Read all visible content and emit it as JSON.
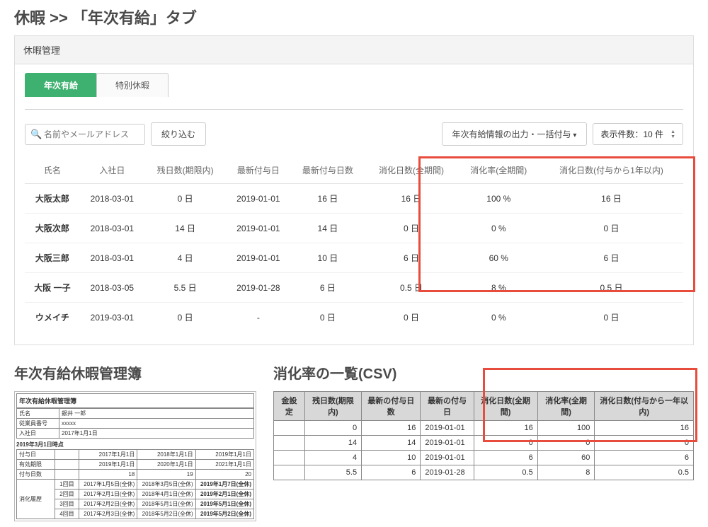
{
  "title": "休暇 >> 「年次有給」タブ",
  "panel_header": "休暇管理",
  "tabs": {
    "active": "年次有給",
    "other": "特別休暇"
  },
  "search": {
    "placeholder": "名前やメールアドレス"
  },
  "filter_btn": "絞り込む",
  "export_btn": "年次有給情報の出力・一括付与",
  "page_size_label": "表示件数：10 件",
  "columns": [
    "氏名",
    "入社日",
    "残日数(期限内)",
    "最新付与日",
    "最新付与日数",
    "消化日数(全期間)",
    "消化率(全期間)",
    "消化日数(付与から1年以内)"
  ],
  "rows": [
    {
      "name": "大阪太郎",
      "hire": "2018-03-01",
      "remain": "0 日",
      "grant": "2019-01-01",
      "grant_days": "16 日",
      "used": "16 日",
      "rate": "100 %",
      "used1y": "16 日",
      "red": false
    },
    {
      "name": "大阪次郎",
      "hire": "2018-03-01",
      "remain": "14 日",
      "grant": "2019-01-01",
      "grant_days": "14 日",
      "used": "0 日",
      "rate": "0 %",
      "used1y": "0 日",
      "red": true
    },
    {
      "name": "大阪三郎",
      "hire": "2018-03-01",
      "remain": "4 日",
      "grant": "2019-01-01",
      "grant_days": "10 日",
      "used": "6 日",
      "rate": "60 %",
      "used1y": "6 日",
      "red": false
    },
    {
      "name": "大阪 一子",
      "hire": "2018-03-05",
      "remain": "5.5 日",
      "grant": "2019-01-28",
      "grant_days": "6 日",
      "used": "0.5 日",
      "rate": "8 %",
      "used1y": "0.5 日",
      "red": true
    },
    {
      "name": "ウメイチ",
      "hire": "2019-03-01",
      "remain": "0 日",
      "grant": "-",
      "grant_days": "0 日",
      "used": "0 日",
      "rate": "0 %",
      "used1y": "0 日",
      "red": true
    }
  ],
  "ledger": {
    "title": "年次有給休暇管理簿",
    "doc_title": "年次有給休暇管理簿",
    "name_label": "氏名",
    "name": "銀井 一郎",
    "emp_label": "従業員番号",
    "emp": "xxxxx",
    "hire_label": "入社日",
    "hire": "2017年1月1日",
    "asof": "2019年3月1日時点",
    "h_grant": "付与日",
    "h_valid": "有効期限",
    "h_grant_days": "付与日数",
    "h_history": "消化履歴",
    "grant_dates": [
      "2017年1月1日",
      "2018年1月1日",
      "2019年1月1日"
    ],
    "valid_dates": [
      "2019年1月1日",
      "2020年1月1日",
      "2021年1月1日"
    ],
    "grant_days": [
      "18",
      "19",
      "20"
    ],
    "history_labels": [
      "1回目",
      "2回目",
      "3回目",
      "4回目"
    ],
    "history": [
      [
        "2017年1月5日(全休)",
        "2018年3月5日(全休)",
        "2019年1月7日(全休)"
      ],
      [
        "2017年2月1日(全休)",
        "2018年4月1日(全休)",
        "2019年2月1日(全休)"
      ],
      [
        "2017年2月2日(全休)",
        "2018年5月1日(全休)",
        "2019年5月1日(全休)"
      ],
      [
        "2017年2月3日(全休)",
        "2018年5月2日(全休)",
        "2019年5月2日(全休)"
      ]
    ]
  },
  "csv": {
    "title": "消化率の一覧(CSV)",
    "headers": [
      "金設定",
      "残日数(期限内)",
      "最新の付与日数",
      "最新の付与日",
      "消化日数(全期間)",
      "消化率(全期間)",
      "消化日数(付与から一年以内)"
    ],
    "rows": [
      [
        "",
        "0",
        "16",
        "2019-01-01",
        "16",
        "100",
        "16"
      ],
      [
        "",
        "14",
        "14",
        "2019-01-01",
        "0",
        "0",
        "0"
      ],
      [
        "",
        "4",
        "10",
        "2019-01-01",
        "6",
        "60",
        "6"
      ],
      [
        "",
        "5.5",
        "6",
        "2019-01-28",
        "0.5",
        "8",
        "0.5"
      ]
    ]
  }
}
